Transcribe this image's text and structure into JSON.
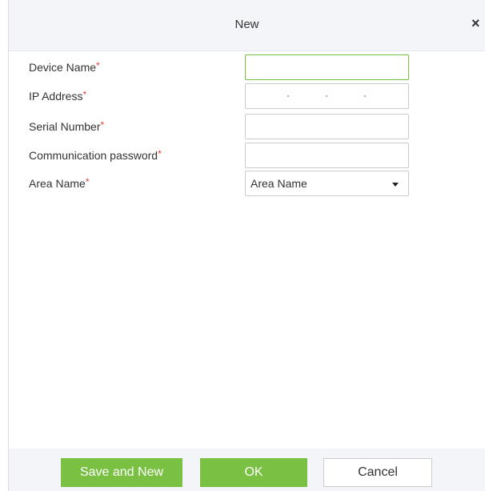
{
  "dialog": {
    "title": "New",
    "close_glyph": "×"
  },
  "form": {
    "device_name": {
      "label": "Device Name",
      "required_mark": "*",
      "value": ""
    },
    "ip_address": {
      "label": "IP Address",
      "required_mark": "*",
      "value": ""
    },
    "serial_number": {
      "label": "Serial Number",
      "required_mark": "*",
      "value": ""
    },
    "communication_password": {
      "label": "Communication password",
      "required_mark": "*",
      "value": ""
    },
    "area_name": {
      "label": "Area Name",
      "required_mark": "*",
      "selected": "Area Name"
    }
  },
  "buttons": {
    "save_and_new": "Save and New",
    "ok": "OK",
    "cancel": "Cancel"
  },
  "colors": {
    "accent": "#7ac143",
    "required": "#e0433b",
    "header_bg": "#f4f5f9"
  }
}
